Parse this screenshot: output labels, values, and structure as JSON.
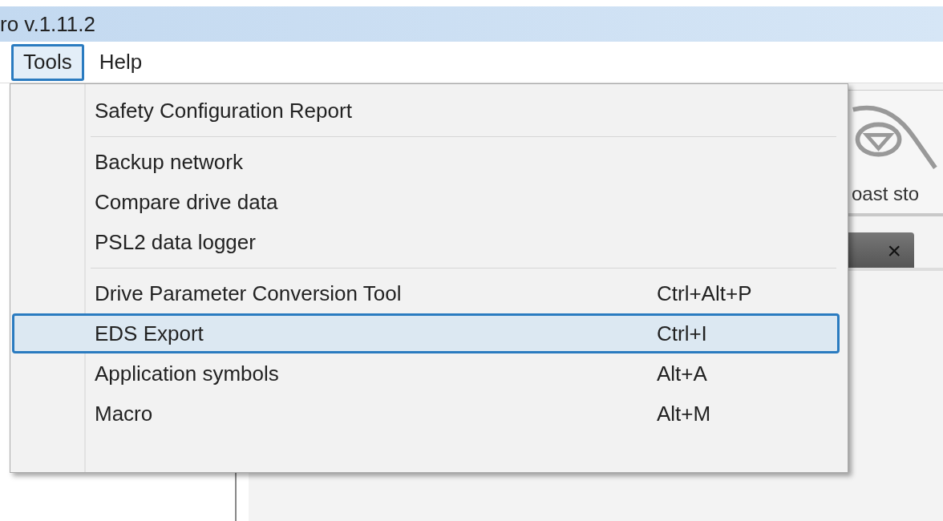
{
  "window": {
    "title": "ro v.1.11.2"
  },
  "menu_bar": [
    {
      "label": "Tools",
      "selected": true
    },
    {
      "label": "Help",
      "selected": false
    }
  ],
  "menu": [
    {
      "kind": "item",
      "label": "Safety Configuration Report",
      "selected": false
    },
    {
      "kind": "separator"
    },
    {
      "kind": "item",
      "label": "Backup network",
      "selected": false
    },
    {
      "kind": "item",
      "label": "Compare drive data",
      "selected": false
    },
    {
      "kind": "item",
      "label": "PSL2 data logger",
      "selected": false
    },
    {
      "kind": "separator"
    },
    {
      "kind": "item",
      "label": "Drive Parameter Conversion Tool",
      "shortcut": "Ctrl+Alt+P",
      "selected": false
    },
    {
      "kind": "item",
      "label": "EDS Export",
      "shortcut": "Ctrl+I",
      "selected": true
    },
    {
      "kind": "item",
      "label": "Application symbols",
      "shortcut": "Alt+A",
      "selected": false
    },
    {
      "kind": "item",
      "label": "Macro",
      "shortcut": "Alt+M",
      "selected": false
    }
  ],
  "toolbar": {
    "button_label": "oast sto"
  },
  "tab": {
    "close": "×"
  }
}
